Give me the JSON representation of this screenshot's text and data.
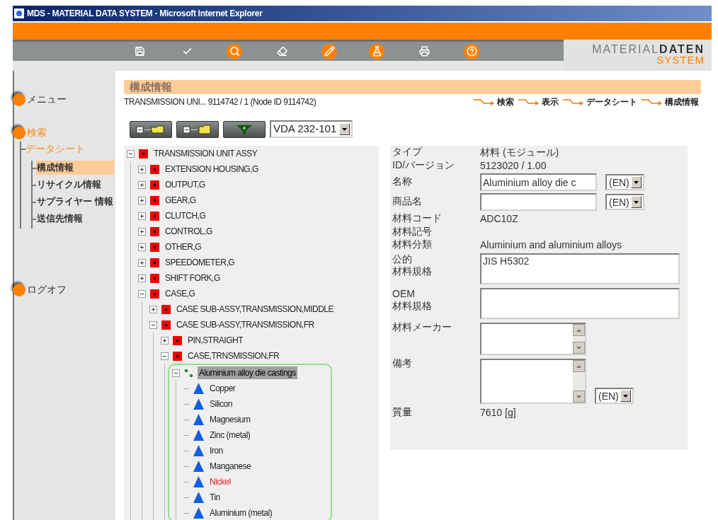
{
  "window": {
    "title": "MDS - MATERIAL DATA SYSTEM - Microsoft Internet Explorer"
  },
  "toolbar": {
    "icons": [
      {
        "kind": "save",
        "highlighted": false
      },
      {
        "kind": "check",
        "highlighted": false
      },
      {
        "kind": "search",
        "highlighted": true
      },
      {
        "kind": "eraser",
        "highlighted": false
      },
      {
        "kind": "pencil",
        "highlighted": true
      },
      {
        "kind": "flask",
        "highlighted": true
      },
      {
        "kind": "printer",
        "highlighted": false
      },
      {
        "kind": "help",
        "highlighted": true
      }
    ],
    "logo": {
      "word_1": "MATERIAL",
      "word_2": "DATEN",
      "word_3": "SYSTEM"
    }
  },
  "sidebar": {
    "items": [
      {
        "label": "メニュー",
        "active": false
      },
      {
        "label": "検索",
        "active": true,
        "children": [
          {
            "label": "データシート",
            "active": true,
            "children": [
              {
                "label": "構成情報",
                "selected": true
              },
              {
                "label": "リサイクル情報",
                "selected": false
              },
              {
                "label": "サプライヤー 情報",
                "selected": false
              },
              {
                "label": "送信先情報",
                "selected": false
              }
            ]
          }
        ]
      },
      {
        "label": "ログオフ",
        "active": false
      }
    ]
  },
  "header": {
    "title": "構成情報",
    "subtitle": "TRANSMISSION UNI... 9114742 / 1 (Node ID 9114742)",
    "breadcrumb": [
      "検索",
      "表示",
      "データシート",
      "構成情報"
    ]
  },
  "tree_toolbar": {
    "buttons": [
      {
        "kind": "expand"
      },
      {
        "kind": "collapse"
      },
      {
        "kind": "filter"
      }
    ],
    "standard": "VDA 232-101"
  },
  "tree": [
    {
      "label": "TRANSMISSION UNIT ASSY",
      "kind": "assembly",
      "expanded": true,
      "selected": false,
      "children": [
        {
          "label": "EXTENSION HOUSING,G",
          "kind": "assembly",
          "expanded": false,
          "selected": false
        },
        {
          "label": "OUTPUT,G",
          "kind": "assembly",
          "expanded": false,
          "selected": false
        },
        {
          "label": "GEAR,G",
          "kind": "assembly",
          "expanded": false,
          "selected": false
        },
        {
          "label": "CLUTCH,G",
          "kind": "assembly",
          "expanded": false,
          "selected": false
        },
        {
          "label": "CONTROL,G",
          "kind": "assembly",
          "expanded": false,
          "selected": false
        },
        {
          "label": "OTHER,G",
          "kind": "assembly",
          "expanded": false,
          "selected": false
        },
        {
          "label": "SPEEDOMETER,G",
          "kind": "assembly",
          "expanded": false,
          "selected": false
        },
        {
          "label": "SHIFT FORK,G",
          "kind": "assembly",
          "expanded": false,
          "selected": false
        },
        {
          "label": "CASE,G",
          "kind": "assembly",
          "expanded": true,
          "selected": false,
          "children": [
            {
              "label": "CASE SUB-ASSY,TRANSMISSION,MIDDLE",
              "kind": "assembly",
              "expanded": false,
              "selected": false
            },
            {
              "label": "CASE SUB-ASSY,TRANSMISSION,FR",
              "kind": "assembly",
              "expanded": true,
              "selected": false,
              "children": [
                {
                  "label": "PIN,STRAIGHT",
                  "kind": "assembly",
                  "expanded": false,
                  "selected": false
                },
                {
                  "label": "CASE,TRNSMISSION,FR",
                  "kind": "assembly",
                  "expanded": true,
                  "selected": false,
                  "children": [
                    {
                      "label": "Aluminium alloy die castings",
                      "kind": "material",
                      "expanded": true,
                      "selected": true,
                      "children": [
                        {
                          "label": "Copper",
                          "kind": "substance",
                          "selected": false,
                          "flagged": false
                        },
                        {
                          "label": "Silicon",
                          "kind": "substance",
                          "selected": false,
                          "flagged": false
                        },
                        {
                          "label": "Magnesium",
                          "kind": "substance",
                          "selected": false,
                          "flagged": false
                        },
                        {
                          "label": "Zinc (metal)",
                          "kind": "substance",
                          "selected": false,
                          "flagged": false
                        },
                        {
                          "label": "Iron",
                          "kind": "substance",
                          "selected": false,
                          "flagged": false
                        },
                        {
                          "label": "Manganese",
                          "kind": "substance",
                          "selected": false,
                          "flagged": false
                        },
                        {
                          "label": "Nickel",
                          "kind": "substance",
                          "selected": false,
                          "flagged": true
                        },
                        {
                          "label": "Tin",
                          "kind": "substance",
                          "selected": false,
                          "flagged": false
                        },
                        {
                          "label": "Aluminium (metal)",
                          "kind": "substance",
                          "selected": false,
                          "flagged": false
                        }
                      ]
                    }
                  ]
                }
              ]
            }
          ]
        }
      ]
    }
  ],
  "details": [
    {
      "label_lines": [
        "タイプ"
      ],
      "kind": "text",
      "value": "材料 (モジュール)"
    },
    {
      "label_lines": [
        "ID/バージョン"
      ],
      "kind": "text",
      "value": "5123020 / 1.00"
    },
    {
      "label_lines": [
        "名称"
      ],
      "kind": "input",
      "value": "Aluminium alloy die c",
      "language": "(EN)"
    },
    {
      "label_lines": [
        "商品名"
      ],
      "kind": "input",
      "language": "(EN)"
    },
    {
      "label_lines": [
        "材料コード"
      ],
      "kind": "text",
      "value": "ADC10Z"
    },
    {
      "label_lines": [
        "材料記号"
      ],
      "kind": "text"
    },
    {
      "label_lines": [
        "材料分類"
      ],
      "kind": "text",
      "value": "Aluminium and aluminium alloys"
    },
    {
      "label_lines": [
        "公的",
        "材料規格"
      ],
      "kind": "textarea",
      "value": "JIS H5302"
    },
    {
      "label_lines": [
        "OEM",
        "材料規格"
      ],
      "kind": "textarea"
    },
    {
      "label_lines": [
        "材料メーカー"
      ],
      "kind": "scrollbox"
    },
    {
      "label_lines": [
        "備考"
      ],
      "kind": "scrollbox",
      "language": "(EN)"
    },
    {
      "label_lines": [
        "質量"
      ],
      "kind": "text",
      "value": "7610 [g]"
    }
  ]
}
